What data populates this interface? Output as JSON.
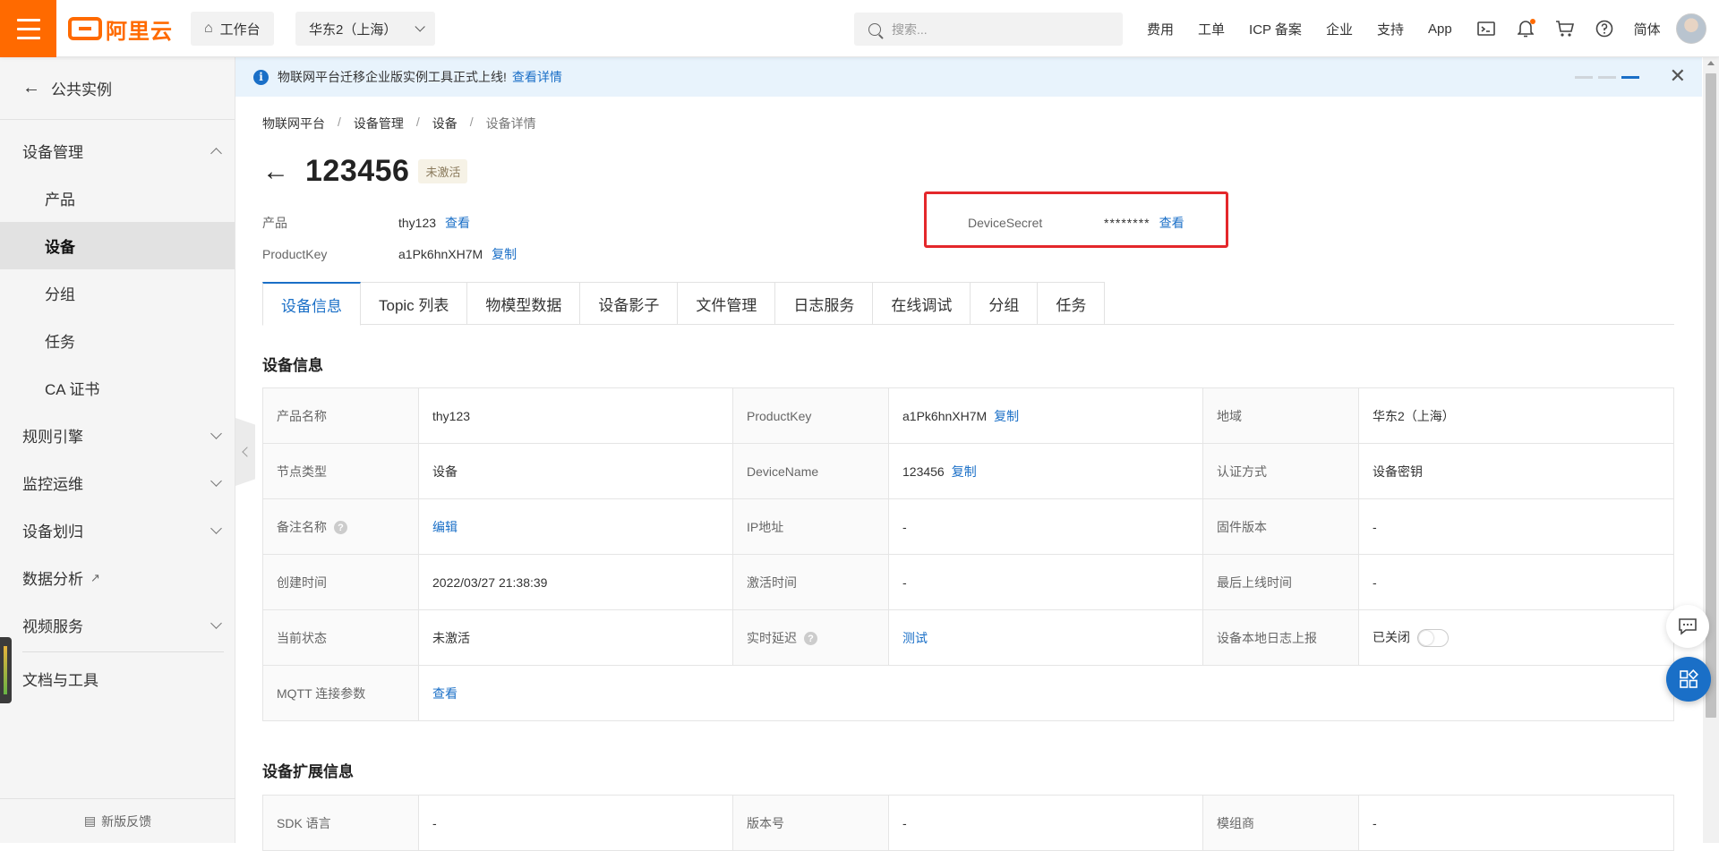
{
  "topbar": {
    "logo_text": "阿里云",
    "workbench": "工作台",
    "region": "华东2（上海）",
    "search_placeholder": "搜索...",
    "links": [
      "费用",
      "工单",
      "ICP 备案",
      "企业",
      "支持",
      "App"
    ],
    "language": "简体",
    "accent_color": "#ff6a00"
  },
  "sidebar": {
    "back_label": "公共实例",
    "items": [
      {
        "label": "设备管理",
        "level": 1,
        "expanded": true
      },
      {
        "label": "产品",
        "level": 2
      },
      {
        "label": "设备",
        "level": 2,
        "active": true
      },
      {
        "label": "分组",
        "level": 2
      },
      {
        "label": "任务",
        "level": 2
      },
      {
        "label": "CA 证书",
        "level": 2
      },
      {
        "label": "规则引擎",
        "level": 1
      },
      {
        "label": "监控运维",
        "level": 1
      },
      {
        "label": "设备划归",
        "level": 1
      },
      {
        "label": "数据分析",
        "level": 1,
        "external": true
      },
      {
        "label": "视频服务",
        "level": 1
      }
    ],
    "docs_label": "文档与工具",
    "feedback_label": "新版反馈"
  },
  "notice": {
    "text": "物联网平台迁移企业版实例工具正式上线!",
    "link": "查看详情"
  },
  "breadcrumb": [
    "物联网平台",
    "设备管理",
    "设备",
    "设备详情"
  ],
  "device": {
    "name": "123456",
    "status_badge": "未激活",
    "product_label": "产品",
    "product_value": "thy123",
    "product_link": "查看",
    "productkey_label": "ProductKey",
    "productkey_value": "a1Pk6hnXH7M",
    "copy_link": "复制",
    "secret_label": "DeviceSecret",
    "secret_value": "********",
    "secret_link": "查看",
    "highlight_color": "#e4272b"
  },
  "tabs": [
    "设备信息",
    "Topic 列表",
    "物模型数据",
    "设备影子",
    "文件管理",
    "日志服务",
    "在线调试",
    "分组",
    "任务"
  ],
  "info_section": {
    "title": "设备信息",
    "rows": [
      {
        "k1": "产品名称",
        "v1": "thy123",
        "k2": "ProductKey",
        "v2": "a1Pk6hnXH7M",
        "v2_link": "复制",
        "k3": "地域",
        "v3": "华东2（上海）"
      },
      {
        "k1": "节点类型",
        "v1": "设备",
        "k2": "DeviceName",
        "v2": "123456",
        "v2_link": "复制",
        "k3": "认证方式",
        "v3": "设备密钥"
      },
      {
        "k1": "备注名称",
        "v1_link": "编辑",
        "k2": "IP地址",
        "v2": "-",
        "k3": "固件版本",
        "v3": "-"
      },
      {
        "k1": "创建时间",
        "v1": "2022/03/27 21:38:39",
        "k2": "激活时间",
        "v2": "-",
        "k3": "最后上线时间",
        "v3": "-"
      },
      {
        "k1": "当前状态",
        "v1": "未激活",
        "k2": "实时延迟",
        "v2_link": "测试",
        "k3": "设备本地日志上报",
        "v3": "已关闭"
      },
      {
        "k1": "MQTT 连接参数",
        "v1_link": "查看"
      }
    ]
  },
  "ext_section": {
    "title": "设备扩展信息",
    "row": {
      "k1": "SDK 语言",
      "v1": "-",
      "k2": "版本号",
      "v2": "-",
      "k3": "模组商",
      "v3": "-"
    }
  }
}
